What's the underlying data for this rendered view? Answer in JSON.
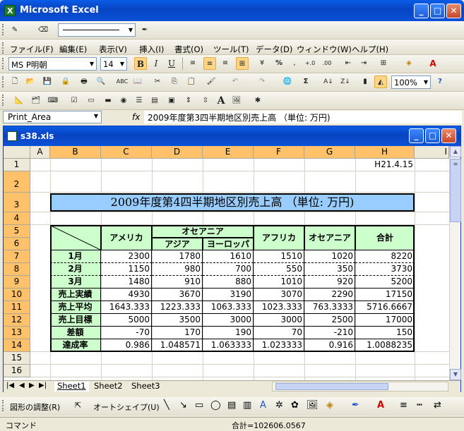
{
  "app": {
    "title": "Microsoft Excel"
  },
  "menu": [
    "ファイル(F)",
    "編集(E)",
    "表示(V)",
    "挿入(I)",
    "書式(O)",
    "ツール(T)",
    "データ(D)",
    "ウィンドウ(W)",
    "ヘルプ(H)"
  ],
  "format_toolbar": {
    "font": "MS P明朝",
    "size": "14"
  },
  "standard_toolbar": {
    "zoom": "100%"
  },
  "formula_bar": {
    "name_box": "Print_Area",
    "fx": "fx",
    "content": "2009年度第3四半期地区別売上高 （単位: 万円)"
  },
  "workbook": {
    "title": "s38.xls"
  },
  "columns": [
    "A",
    "B",
    "C",
    "D",
    "E",
    "F",
    "G",
    "H",
    "I"
  ],
  "rows": [
    "1",
    "2",
    "3",
    "4",
    "5",
    "6",
    "7",
    "8",
    "9",
    "10",
    "11",
    "12",
    "13",
    "14",
    "15",
    "16"
  ],
  "sheet": {
    "date": "H21.4.15",
    "title": "2009年度第4四半期地区別売上高 （単位: 万円)",
    "headers": {
      "america": "アメリカ",
      "oceania_group": "オセアニア",
      "asia": "アジア",
      "europe": "ヨーロッパ",
      "africa": "アフリカ",
      "oceania": "オセアニア",
      "total": "合計"
    },
    "table": [
      {
        "label": "1月",
        "values": [
          "2300",
          "1780",
          "1610",
          "1510",
          "1020",
          "8220"
        ]
      },
      {
        "label": "2月",
        "values": [
          "1150",
          "980",
          "700",
          "550",
          "350",
          "3730"
        ]
      },
      {
        "label": "3月",
        "values": [
          "1480",
          "910",
          "880",
          "1010",
          "920",
          "5200"
        ]
      },
      {
        "label": "売上実績",
        "values": [
          "4930",
          "3670",
          "3190",
          "3070",
          "2290",
          "17150"
        ]
      },
      {
        "label": "売上平均",
        "values": [
          "1643.333",
          "1223.333",
          "1063.333",
          "1023.333",
          "763.3333",
          "5716.6667"
        ]
      },
      {
        "label": "売上目標",
        "values": [
          "5000",
          "3500",
          "3000",
          "3000",
          "2500",
          "17000"
        ]
      },
      {
        "label": "差額",
        "values": [
          "-70",
          "170",
          "190",
          "70",
          "-210",
          "150"
        ]
      },
      {
        "label": "達成率",
        "values": [
          "0.986",
          "1.048571",
          "1.063333",
          "1.023333",
          "0.916",
          "1.0088235"
        ]
      }
    ]
  },
  "tabs": [
    "Sheet1",
    "Sheet2",
    "Sheet3"
  ],
  "drawing": {
    "adjust": "図形の調整(R)",
    "autoshape": "オートシェイプ(U)"
  },
  "status": {
    "mode": "コマンド",
    "sum": "合計=102606.0567"
  }
}
